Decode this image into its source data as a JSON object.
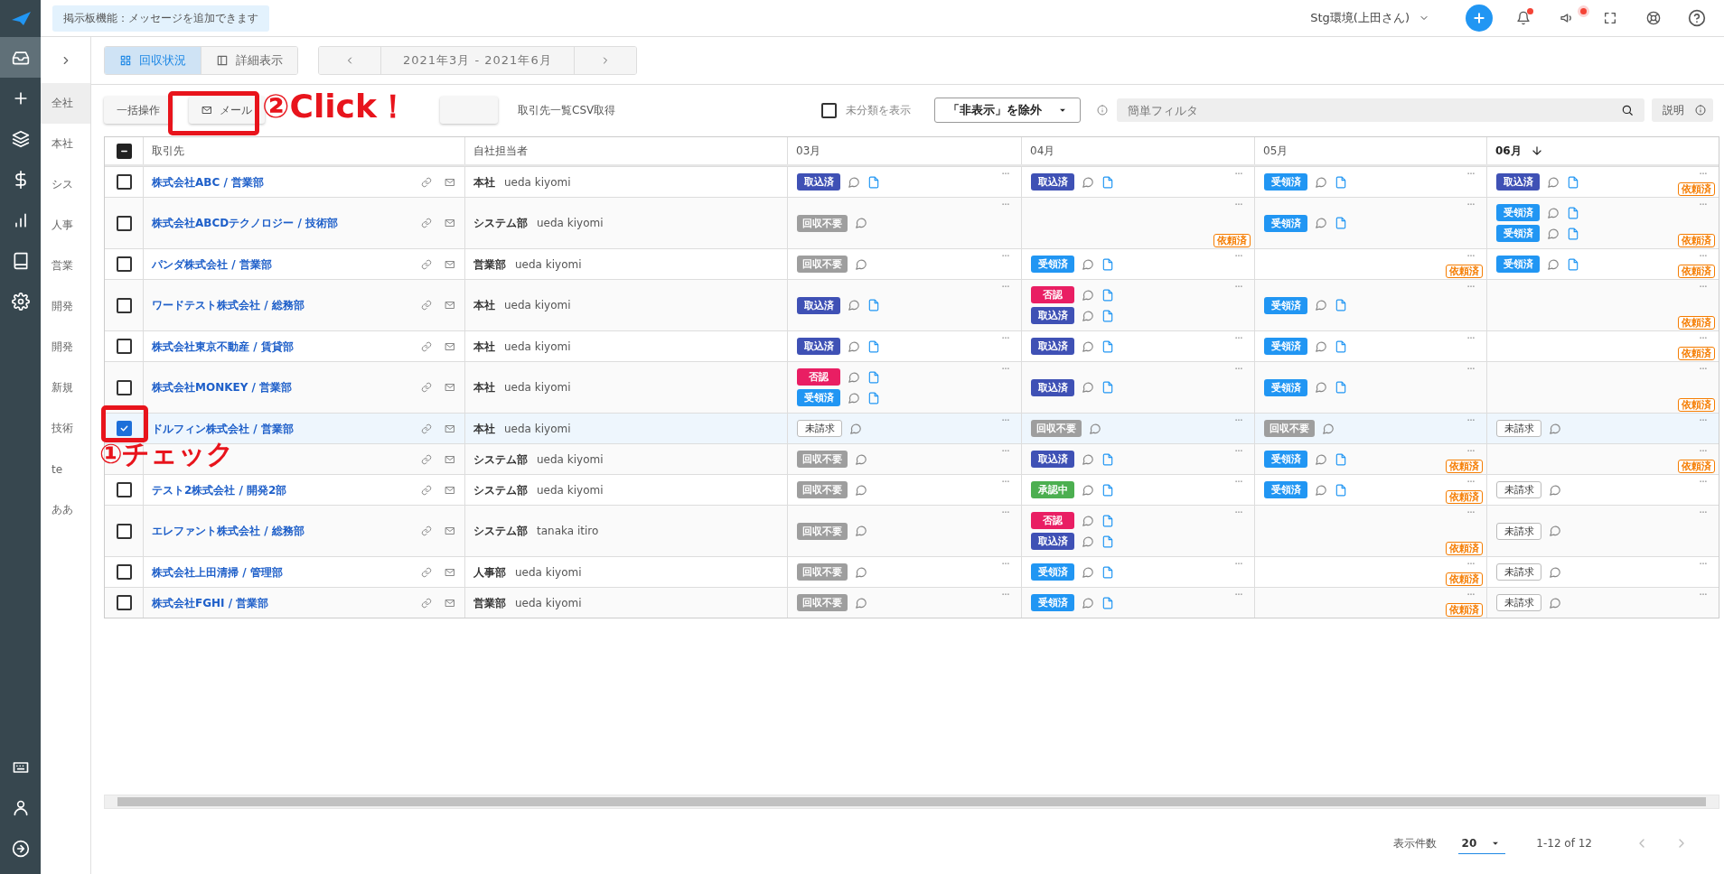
{
  "header": {
    "notice": "掲示板機能：メッセージを追加できます",
    "environment": "Stg環境(上田さん)",
    "bell_unread": true,
    "announce_unread": true
  },
  "rail": {
    "items": [
      {
        "selected": true
      },
      {
        "selected": false
      },
      {
        "selected": false
      },
      {
        "selected": false
      },
      {
        "selected": false
      },
      {
        "selected": false
      },
      {
        "selected": false
      }
    ]
  },
  "subnav": {
    "items": [
      {
        "label": "全社",
        "selected": true
      },
      {
        "label": "本社",
        "selected": false
      },
      {
        "label": "シス",
        "selected": false
      },
      {
        "label": "人事",
        "selected": false
      },
      {
        "label": "営業",
        "selected": false
      },
      {
        "label": "開発",
        "selected": false
      },
      {
        "label": "開発",
        "selected": false
      },
      {
        "label": "新規",
        "selected": false
      },
      {
        "label": "技術",
        "selected": false
      },
      {
        "label": "te",
        "selected": false
      },
      {
        "label": "ああ",
        "selected": false
      }
    ]
  },
  "view_tabs": [
    {
      "label": "回収状況",
      "selected": true
    },
    {
      "label": "詳細表示",
      "selected": false
    }
  ],
  "period": "2021年3月 - 2021年6月",
  "toolbar": {
    "buttons": [
      {
        "kind": "plain",
        "label": "一括操作"
      },
      {
        "kind": "mail",
        "label": "メール"
      },
      {
        "kind": "plain"
      }
    ],
    "csv_link": "取引先一覧CSV取得",
    "unclassified": {
      "label": "未分類を表示",
      "checked": false
    },
    "filter_dropdown": "「非表示」を除外",
    "search": {
      "placeholder": "簡単フィルタ"
    },
    "help_button": "説明"
  },
  "table": {
    "select_all": {
      "indeterminate": true
    },
    "columns": [
      {
        "label": "取引先",
        "sorted": false
      },
      {
        "label": "自社担当者",
        "sorted": false
      },
      {
        "label": "03月",
        "sorted": false
      },
      {
        "label": "04月",
        "sorted": false
      },
      {
        "label": "05月",
        "sorted": false
      },
      {
        "label": "06月",
        "sorted": true
      }
    ],
    "rows": [
      {
        "checked": false,
        "selected": false,
        "company": "株式会社ABC / 営業部",
        "department": "本社",
        "person": "ueda kiyomi",
        "months": [
          {
            "entries": [
              {
                "kind": "imported",
                "status": "取込済",
                "file": true
              }
            ]
          },
          {
            "entries": [
              {
                "kind": "imported",
                "status": "取込済",
                "file": true
              }
            ]
          },
          {
            "entries": [
              {
                "kind": "received",
                "status": "受領済",
                "file": true
              }
            ]
          },
          {
            "entries": [
              {
                "kind": "imported",
                "status": "取込済",
                "file": true
              }
            ],
            "request_tag": "依頼済"
          }
        ]
      },
      {
        "checked": false,
        "selected": false,
        "company": "株式会社ABCDテクノロジー / 技術部",
        "department": "システム部",
        "person": "ueda kiyomi",
        "months": [
          {
            "entries": [
              {
                "kind": "unneeded",
                "status": "回収不要",
                "file": false
              }
            ]
          },
          {
            "request_tag": "依頼済"
          },
          {
            "entries": [
              {
                "kind": "received",
                "status": "受領済",
                "file": true
              }
            ]
          },
          {
            "entries": [
              {
                "kind": "received",
                "status": "受領済",
                "file": true
              },
              {
                "kind": "received",
                "status": "受領済",
                "file": true
              }
            ],
            "request_tag": "依頼済"
          }
        ]
      },
      {
        "checked": false,
        "selected": false,
        "company": "パンダ株式会社 / 営業部",
        "department": "営業部",
        "person": "ueda kiyomi",
        "months": [
          {
            "entries": [
              {
                "kind": "unneeded",
                "status": "回収不要",
                "file": false
              }
            ]
          },
          {
            "entries": [
              {
                "kind": "received",
                "status": "受領済",
                "file": true
              }
            ]
          },
          {
            "request_tag": "依頼済"
          },
          {
            "entries": [
              {
                "kind": "received",
                "status": "受領済",
                "file": true
              }
            ],
            "request_tag": "依頼済"
          }
        ]
      },
      {
        "checked": false,
        "selected": false,
        "company": "ワードテスト株式会社 / 総務部",
        "department": "本社",
        "person": "ueda kiyomi",
        "months": [
          {
            "entries": [
              {
                "kind": "imported",
                "status": "取込済",
                "file": true
              }
            ]
          },
          {
            "entries": [
              {
                "kind": "rejected",
                "status": "否認",
                "file": true
              },
              {
                "kind": "imported",
                "status": "取込済",
                "file": true
              }
            ]
          },
          {
            "entries": [
              {
                "kind": "received",
                "status": "受領済",
                "file": true
              }
            ]
          },
          {
            "request_tag": "依頼済"
          }
        ]
      },
      {
        "checked": false,
        "selected": false,
        "company": "株式会社東京不動産 / 賃貸部",
        "department": "本社",
        "person": "ueda kiyomi",
        "months": [
          {
            "entries": [
              {
                "kind": "imported",
                "status": "取込済",
                "file": true
              }
            ]
          },
          {
            "entries": [
              {
                "kind": "imported",
                "status": "取込済",
                "file": true
              }
            ]
          },
          {
            "entries": [
              {
                "kind": "received",
                "status": "受領済",
                "file": true
              }
            ]
          },
          {
            "request_tag": "依頼済"
          }
        ]
      },
      {
        "checked": false,
        "selected": false,
        "company": "株式会社MONKEY / 営業部",
        "department": "本社",
        "person": "ueda kiyomi",
        "months": [
          {
            "entries": [
              {
                "kind": "rejected",
                "status": "否認",
                "file": true
              },
              {
                "kind": "received",
                "status": "受領済",
                "file": true
              }
            ]
          },
          {
            "entries": [
              {
                "kind": "imported",
                "status": "取込済",
                "file": true
              }
            ]
          },
          {
            "entries": [
              {
                "kind": "received",
                "status": "受領済",
                "file": true
              }
            ]
          },
          {
            "request_tag": "依頼済"
          }
        ]
      },
      {
        "checked": true,
        "selected": true,
        "company": "ドルフィン株式会社 / 営業部",
        "department": "本社",
        "person": "ueda kiyomi",
        "months": [
          {
            "entries": [
              {
                "kind": "unbilled",
                "status": "未請求",
                "file": false
              }
            ]
          },
          {
            "entries": [
              {
                "kind": "unneeded",
                "status": "回収不要",
                "file": false
              }
            ]
          },
          {
            "entries": [
              {
                "kind": "unneeded",
                "status": "回収不要",
                "file": false
              }
            ]
          },
          {
            "entries": [
              {
                "kind": "unbilled",
                "status": "未請求",
                "file": false
              }
            ]
          }
        ]
      },
      {
        "selected": false,
        "department": "システム部",
        "person": "ueda kiyomi",
        "months": [
          {
            "entries": [
              {
                "kind": "unneeded",
                "status": "回収不要",
                "file": false
              }
            ]
          },
          {
            "entries": [
              {
                "kind": "imported",
                "status": "取込済",
                "file": true
              }
            ]
          },
          {
            "entries": [
              {
                "kind": "received",
                "status": "受領済",
                "file": true
              }
            ],
            "request_tag": "依頼済"
          },
          {
            "request_tag": "依頼済"
          }
        ]
      },
      {
        "checked": false,
        "selected": false,
        "company": "テスト2株式会社 / 開発2部",
        "department": "システム部",
        "person": "ueda kiyomi",
        "months": [
          {
            "entries": [
              {
                "kind": "unneeded",
                "status": "回収不要",
                "file": false
              }
            ]
          },
          {
            "entries": [
              {
                "kind": "pending",
                "status": "承認中",
                "file": true
              }
            ]
          },
          {
            "entries": [
              {
                "kind": "received",
                "status": "受領済",
                "file": true
              }
            ],
            "request_tag": "依頼済"
          },
          {
            "entries": [
              {
                "kind": "unbilled",
                "status": "未請求",
                "file": false
              }
            ]
          }
        ]
      },
      {
        "checked": false,
        "selected": false,
        "company": "エレファント株式会社 / 総務部",
        "department": "システム部",
        "person": "tanaka itiro",
        "months": [
          {
            "entries": [
              {
                "kind": "unneeded",
                "status": "回収不要",
                "file": false
              }
            ]
          },
          {
            "entries": [
              {
                "kind": "rejected",
                "status": "否認",
                "file": true
              },
              {
                "kind": "imported",
                "status": "取込済",
                "file": true
              }
            ]
          },
          {
            "request_tag": "依頼済"
          },
          {
            "entries": [
              {
                "kind": "unbilled",
                "status": "未請求",
                "file": false
              }
            ]
          }
        ]
      },
      {
        "checked": false,
        "selected": false,
        "company": "株式会社上田清掃 / 管理部",
        "department": "人事部",
        "person": "ueda kiyomi",
        "months": [
          {
            "entries": [
              {
                "kind": "unneeded",
                "status": "回収不要",
                "file": false
              }
            ]
          },
          {
            "entries": [
              {
                "kind": "received",
                "status": "受領済",
                "file": true
              }
            ]
          },
          {
            "request_tag": "依頼済"
          },
          {
            "entries": [
              {
                "kind": "unbilled",
                "status": "未請求",
                "file": false
              }
            ]
          }
        ]
      },
      {
        "checked": false,
        "selected": false,
        "company": "株式会社FGHI / 営業部",
        "department": "営業部",
        "person": "ueda kiyomi",
        "months": [
          {
            "entries": [
              {
                "kind": "unneeded",
                "status": "回収不要",
                "file": false
              }
            ]
          },
          {
            "entries": [
              {
                "kind": "received",
                "status": "受領済",
                "file": true
              }
            ]
          },
          {
            "request_tag": "依頼済"
          },
          {
            "entries": [
              {
                "kind": "unbilled",
                "status": "未請求",
                "file": false
              }
            ]
          }
        ]
      }
    ]
  },
  "pagination": {
    "rows_per_page_label": "表示件数",
    "rows_per_page": "20",
    "range": "1-12 of 12"
  },
  "annotations": [
    {
      "label": "①チェック"
    },
    {
      "label": "②Click！"
    }
  ]
}
